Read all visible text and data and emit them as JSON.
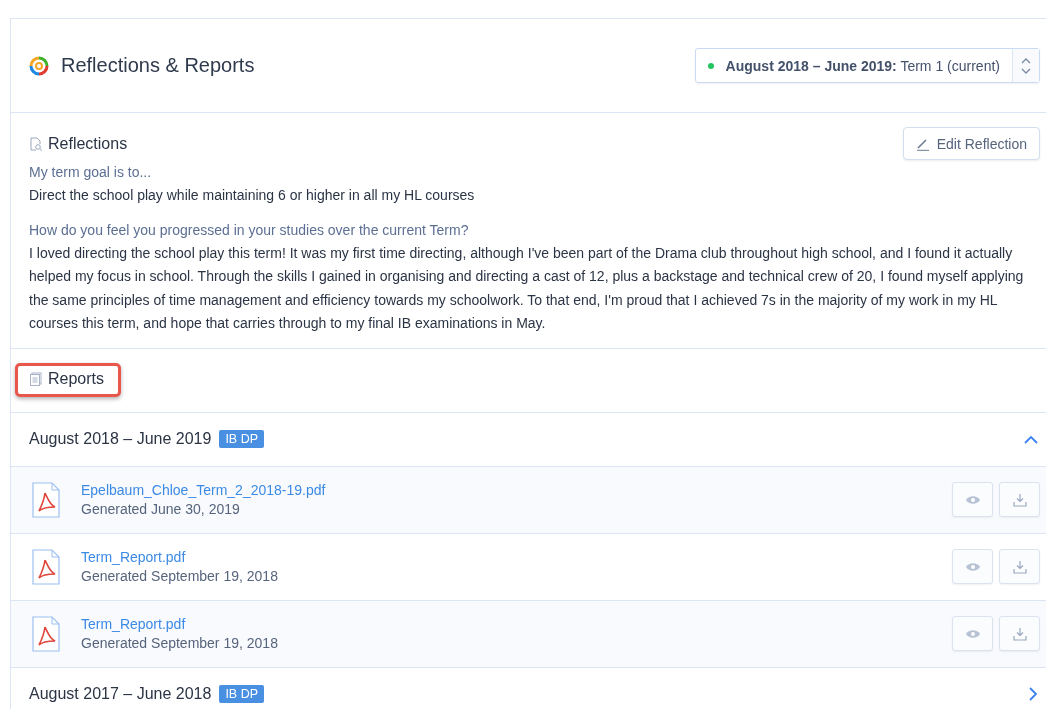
{
  "header": {
    "title": "Reflections & Reports",
    "term_selector": {
      "color": "#22c55e",
      "period": "August 2018 – June 2019:",
      "term": "Term 1 (current)"
    }
  },
  "reflections": {
    "title": "Reflections",
    "edit_button": "Edit Reflection",
    "entries": [
      {
        "question": "My term goal is to...",
        "answer": "Direct the school play while maintaining 6 or higher in all my HL courses"
      },
      {
        "question": "How do you feel you progressed in your studies over the current Term?",
        "answer": "I loved directing the school play this term! It was my first time directing, although I've been part of the Drama club throughout high school, and I found it actually helped my focus in school. Through the skills I gained in organising and directing a cast of 12, plus a backstage and technical crew of 20, I found myself applying the same principles of time management and efficiency towards my schoolwork. To that end, I'm proud that I achieved 7s in the majority of my work in my HL courses this term, and hope that carries through to my final IB examinations in May."
      }
    ]
  },
  "reports": {
    "title": "Reports",
    "groups": [
      {
        "period": "August 2018 – June 2019",
        "badge": "IB DP",
        "expanded": true,
        "files": [
          {
            "name": "Epelbaum_Chloe_Term_2_2018-19.pdf",
            "generated": "Generated June 30, 2019"
          },
          {
            "name": "Term_Report.pdf",
            "generated": "Generated September 19, 2018"
          },
          {
            "name": "Term_Report.pdf",
            "generated": "Generated September 19, 2018"
          }
        ]
      },
      {
        "period": "August 2017 – June 2018",
        "badge": "IB DP",
        "expanded": false
      }
    ]
  }
}
